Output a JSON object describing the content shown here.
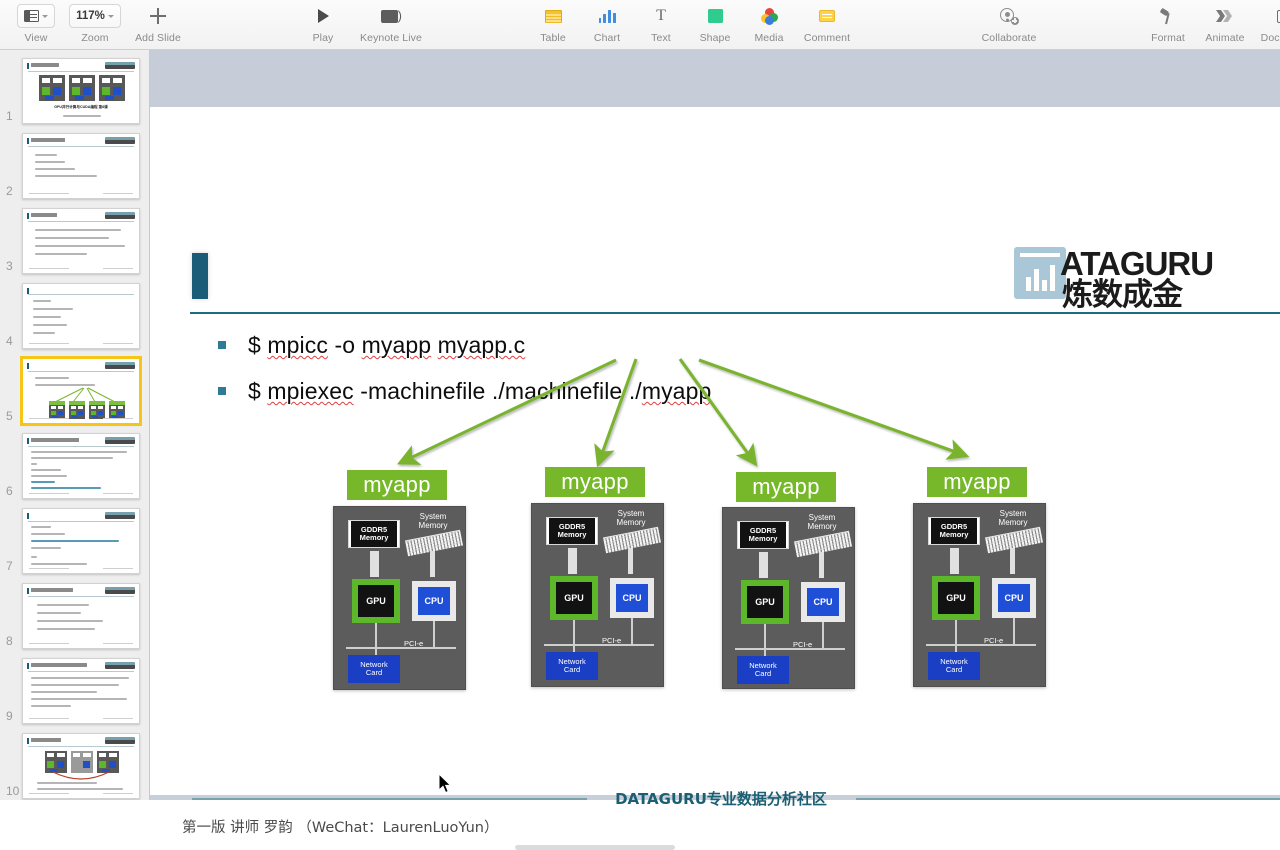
{
  "app": {
    "name": "Keynote"
  },
  "toolbar": {
    "left": [
      {
        "name": "view",
        "label": "View",
        "icon": "view-icon",
        "has_chevron": true
      },
      {
        "name": "zoom",
        "label": "Zoom",
        "icon": "zoom-value",
        "value": "117%",
        "has_chevron": true
      },
      {
        "name": "add-slide",
        "label": "Add Slide",
        "icon": "plus-icon",
        "has_chevron": false
      }
    ],
    "play_group": [
      {
        "name": "play",
        "label": "Play",
        "icon": "play-icon"
      },
      {
        "name": "keynote-live",
        "label": "Keynote Live",
        "icon": "keynote-live-icon"
      }
    ],
    "insert_group": [
      {
        "name": "table",
        "label": "Table",
        "icon": "table-icon"
      },
      {
        "name": "chart",
        "label": "Chart",
        "icon": "chart-icon"
      },
      {
        "name": "text",
        "label": "Text",
        "icon": "text-icon"
      },
      {
        "name": "shape",
        "label": "Shape",
        "icon": "shape-icon"
      },
      {
        "name": "media",
        "label": "Media",
        "icon": "media-icon"
      },
      {
        "name": "comment",
        "label": "Comment",
        "icon": "comment-icon"
      }
    ],
    "collaborate": {
      "name": "collaborate",
      "label": "Collaborate",
      "icon": "collaborate-icon"
    },
    "right_group": [
      {
        "name": "format",
        "label": "Format",
        "icon": "format-brush-icon"
      },
      {
        "name": "animate",
        "label": "Animate",
        "icon": "animate-icon"
      },
      {
        "name": "document",
        "label": "Document",
        "icon": "document-icon"
      }
    ]
  },
  "sidebar": {
    "selected_index": 4,
    "slides": [
      {
        "number": "1",
        "kind": "nodes-title"
      },
      {
        "number": "2",
        "kind": "bullets"
      },
      {
        "number": "3",
        "kind": "bullets"
      },
      {
        "number": "4",
        "kind": "bullets-sparse"
      },
      {
        "number": "5",
        "kind": "fanout-nodes"
      },
      {
        "number": "6",
        "kind": "code"
      },
      {
        "number": "7",
        "kind": "code"
      },
      {
        "number": "8",
        "kind": "bullets"
      },
      {
        "number": "9",
        "kind": "bullets"
      },
      {
        "number": "10",
        "kind": "nodes-pair"
      }
    ]
  },
  "slide": {
    "bullets": [
      {
        "marker": "square",
        "text": "$ mpicc  -o myapp myapp.c"
      },
      {
        "marker": "square",
        "text": "$ mpiexec -machinefile ./machinefile  ./myapp"
      }
    ],
    "logo": {
      "wordmark": "ATAGURU",
      "chinese": "炼数成金",
      "mark": "bar-chart-mark"
    },
    "nodes": [
      {
        "app_label": "myapp"
      },
      {
        "app_label": "myapp"
      },
      {
        "app_label": "myapp"
      },
      {
        "app_label": "myapp"
      }
    ],
    "node_parts": {
      "gddr5": "GDDR5\nMemory",
      "gddr5_line1": "GDDR5",
      "gddr5_line2": "Memory",
      "system_memory_line1": "System",
      "system_memory_line2": "Memory",
      "gpu": "GPU",
      "cpu": "CPU",
      "bus": "PCI-e",
      "nic_line1": "Network",
      "nic_line2": "Card"
    },
    "footer": {
      "center": "DATAGURU专业数据分析社区",
      "left": "第一版 讲师 罗韵 （WeChat：LaurenLuoYun）"
    },
    "colors": {
      "accent_teal": "#1a5c78",
      "rule_teal": "#1c6c86",
      "bullet_square": "#2e7b96",
      "arrow_green": "#7ab32e",
      "myapp_green": "#77b82a",
      "node_gray": "#5c5c5c",
      "gpu_green": "#5cb82a",
      "cpu_blue": "#1e4fd6",
      "nic_blue": "#1a3fc4",
      "footer_teal": "#1b5f73",
      "canvas_bg": "#c7cdd8"
    }
  }
}
